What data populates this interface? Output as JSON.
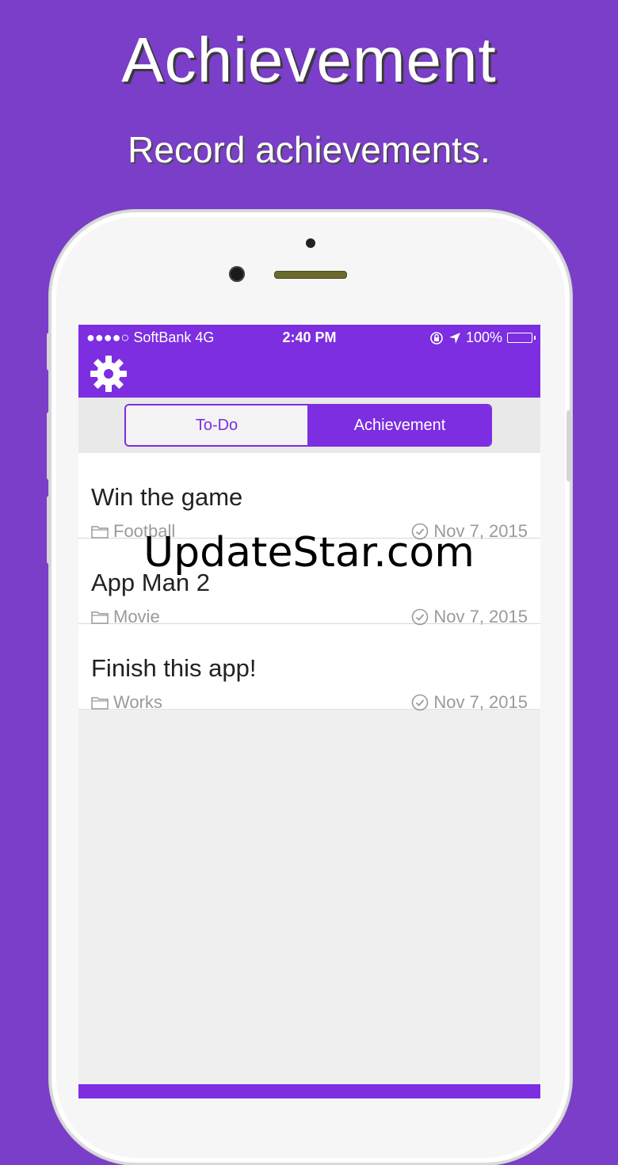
{
  "promo": {
    "title": "Achievement",
    "subtitle": "Record achievements."
  },
  "status_bar": {
    "carrier": "●●●●○ SoftBank   4G",
    "time": "2:40 PM",
    "battery": "100%"
  },
  "nav": {
    "settings_icon": "gear-icon"
  },
  "segment": {
    "todo_label": "To-Do",
    "achievement_label": "Achievement",
    "selected": "Achievement"
  },
  "items": [
    {
      "title": "Win the game",
      "category": "Football",
      "date": "Nov 7, 2015"
    },
    {
      "title": "App Man 2",
      "category": "Movie",
      "date": "Nov 7, 2015"
    },
    {
      "title": "Finish this app!",
      "category": "Works",
      "date": "Nov 7, 2015"
    }
  ],
  "watermark": "UpdateStar.com",
  "colors": {
    "background": "#7a3ec8",
    "accent": "#7c2ee0"
  }
}
